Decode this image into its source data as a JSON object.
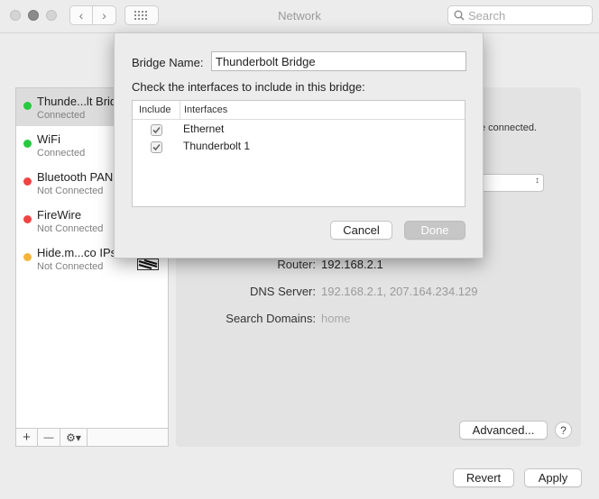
{
  "window": {
    "title": "Network",
    "search_placeholder": "Search"
  },
  "sidebar": {
    "services": [
      {
        "name": "Thunde...lt Bridge",
        "status": "Connected",
        "color": "#27c93f",
        "selected": true
      },
      {
        "name": "WiFi",
        "status": "Connected",
        "color": "#27c93f",
        "selected": false
      },
      {
        "name": "Bluetooth PAN",
        "status": "Not Connected",
        "color": "#ef4444",
        "selected": false
      },
      {
        "name": "FireWire",
        "status": "Not Connected",
        "color": "#ef4444",
        "selected": false
      },
      {
        "name": "Hide.m...co IPsec",
        "status": "Not Connected",
        "color": "#f5b53b",
        "selected": false
      }
    ],
    "toolbar": {
      "add": "+",
      "remove": "—",
      "action": "⚙▾"
    }
  },
  "pane": {
    "status_fragment": "e connected.",
    "router_label": "Router:",
    "router_value": "192.168.2.1",
    "dns_label": "DNS Server:",
    "dns_value": "192.168.2.1, 207.164.234.129",
    "search_domains_label": "Search Domains:",
    "search_domains_value": "home",
    "advanced_button": "Advanced...",
    "help_button": "?"
  },
  "footer": {
    "revert_button": "Revert",
    "apply_button": "Apply"
  },
  "sheet": {
    "bridge_name_label": "Bridge Name:",
    "bridge_name_value": "Thunderbolt Bridge",
    "instruction": "Check the interfaces to include in this bridge:",
    "columns": {
      "include": "Include",
      "interfaces": "Interfaces"
    },
    "interfaces": [
      {
        "name": "Ethernet",
        "checked": true
      },
      {
        "name": "Thunderbolt 1",
        "checked": true
      }
    ],
    "cancel_button": "Cancel",
    "done_button": "Done"
  }
}
